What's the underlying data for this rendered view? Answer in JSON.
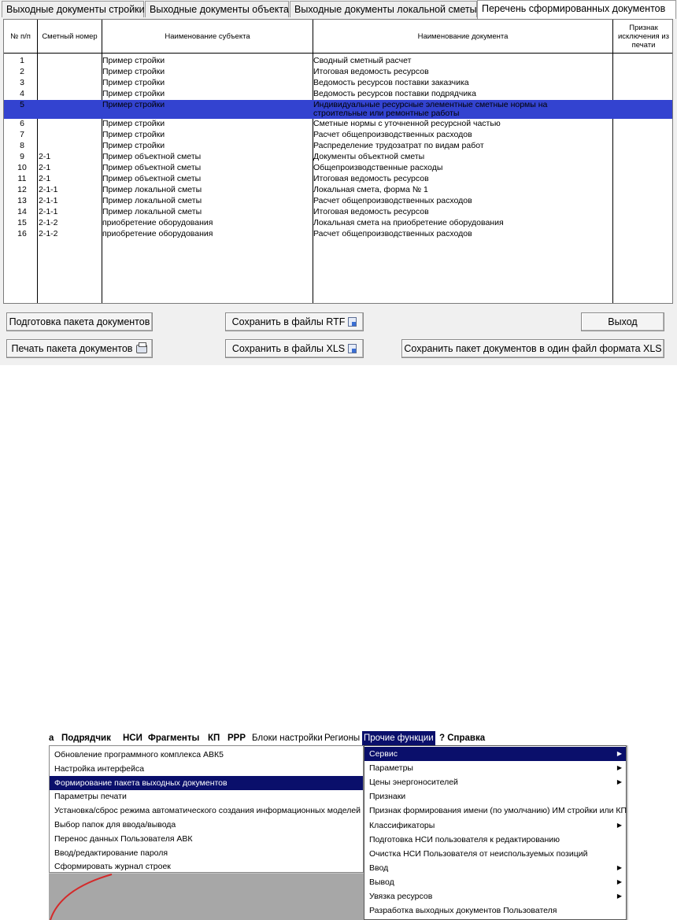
{
  "tabs": [
    {
      "label": "Выходные документы стройки"
    },
    {
      "label": "Выходные документы объекта"
    },
    {
      "label": "Выходные документы локальной сметы"
    },
    {
      "label": "Перечень сформированных документов"
    }
  ],
  "table": {
    "headers": {
      "num": "№ п/п",
      "smeta": "Сметный номер",
      "subject": "Наименование субъекта",
      "doc": "Наименование документа",
      "flag": "Признак исключения из печати"
    },
    "rows": [
      {
        "num": "1",
        "smeta": "",
        "subject": "Пример стройки",
        "doc": "Сводный сметный расчет"
      },
      {
        "num": "2",
        "smeta": "",
        "subject": "Пример стройки",
        "doc": "Итоговая ведомость ресурсов"
      },
      {
        "num": "3",
        "smeta": "",
        "subject": "Пример стройки",
        "doc": "Ведомость ресурсов поставки заказчика"
      },
      {
        "num": "4",
        "smeta": "",
        "subject": "Пример стройки",
        "doc": "Ведомость ресурсов поставки подрядчика"
      },
      {
        "num": "5",
        "smeta": "",
        "subject": "Пример стройки",
        "doc": "Индивидуальные ресурсные элементные сметные нормы на",
        "doc2": "строительные или ремонтные работы"
      },
      {
        "num": "6",
        "smeta": "",
        "subject": "Пример стройки",
        "doc": "Сметные нормы с уточненной ресурсной частью"
      },
      {
        "num": "7",
        "smeta": "",
        "subject": "Пример стройки",
        "doc": "Расчет общепроизводственных расходов"
      },
      {
        "num": "8",
        "smeta": "",
        "subject": "Пример стройки",
        "doc": "Распределение трудозатрат по видам работ"
      },
      {
        "num": "9",
        "smeta": "2-1",
        "subject": "Пример объектной сметы",
        "doc": "Документы объектной сметы"
      },
      {
        "num": "10",
        "smeta": "2-1",
        "subject": "Пример объектной сметы",
        "doc": "Общепроизводственные расходы"
      },
      {
        "num": "11",
        "smeta": "2-1",
        "subject": "Пример объектной сметы",
        "doc": "Итоговая ведомость ресурсов"
      },
      {
        "num": "12",
        "smeta": "2-1-1",
        "subject": "Пример локальной сметы",
        "doc": "Локальная смета, форма № 1"
      },
      {
        "num": "13",
        "smeta": "2-1-1",
        "subject": "Пример локальной сметы",
        "doc": "Расчет общепроизводственных расходов"
      },
      {
        "num": "14",
        "smeta": "2-1-1",
        "subject": "Пример локальной сметы",
        "doc": "Итоговая ведомость ресурсов"
      },
      {
        "num": "15",
        "smeta": "2-1-2",
        "subject": "приобретение оборудования",
        "doc": "Локальная смета на приобретение оборудования"
      },
      {
        "num": "16",
        "smeta": "2-1-2",
        "subject": "приобретение оборудования",
        "doc": "Расчет общепроизводственных расходов"
      }
    ]
  },
  "buttons": {
    "prepare": "Подготовка пакета документов",
    "print": "Печать пакета документов",
    "save_rtf": "Сохранить в файлы  RTF",
    "save_xls": "Сохранить в файлы XLS",
    "exit": "Выход",
    "save_one_xls": "Сохранить пакет документов в один файл формата XLS"
  },
  "menubar": [
    {
      "label": "а",
      "style": "bold"
    },
    {
      "label": "Подрядчик",
      "style": "bold"
    },
    {
      "label": "НСИ",
      "style": "bold"
    },
    {
      "label": "Фрагменты",
      "style": "bold"
    },
    {
      "label": "КП",
      "style": "bold"
    },
    {
      "label": "РРР",
      "style": "bold"
    },
    {
      "label": "Блоки настройки",
      "style": "plain"
    },
    {
      "label": "Регионы",
      "style": "plain"
    },
    {
      "label": "Прочие функции",
      "style": "active"
    },
    {
      "label": "? Справка",
      "style": "bold"
    }
  ],
  "menu_left": [
    "Обновление программного комплекса АВК5",
    "Настройка интерфейса",
    "Формирование пакета выходных документов",
    "Параметры печати",
    "Установка/сброс режима автоматического создания информационных моделей",
    "Выбор папок для ввода/вывода",
    "Перенос данных Пользователя АВК",
    "Ввод/редактирование пароля",
    "Сформировать журнал строек"
  ],
  "menu_right": [
    {
      "label": "Сервис",
      "arrow": true
    },
    {
      "label": "Параметры",
      "arrow": true
    },
    {
      "label": "Цены энергоносителей",
      "arrow": true
    },
    {
      "label": "Признаки",
      "arrow": false
    },
    {
      "label": "Признак формирования имени (по умолчанию) ИМ стройки или КП",
      "arrow": false
    },
    {
      "label": "Классификаторы",
      "arrow": true
    },
    {
      "label": "Подготовка НСИ пользователя к редактированию",
      "arrow": false
    },
    {
      "label": "Очистка НСИ Пользователя от неиспользуемых позиций",
      "arrow": false
    },
    {
      "label": "Ввод",
      "arrow": true
    },
    {
      "label": "Вывод",
      "arrow": true
    },
    {
      "label": "Увязка ресурсов",
      "arrow": true
    },
    {
      "label": "Разработка выходных документов Пользователя",
      "arrow": false
    }
  ],
  "colors": {
    "selection": "#3343d0",
    "menu_highlight": "#0a0f6b",
    "curve": "#d42a2a"
  }
}
